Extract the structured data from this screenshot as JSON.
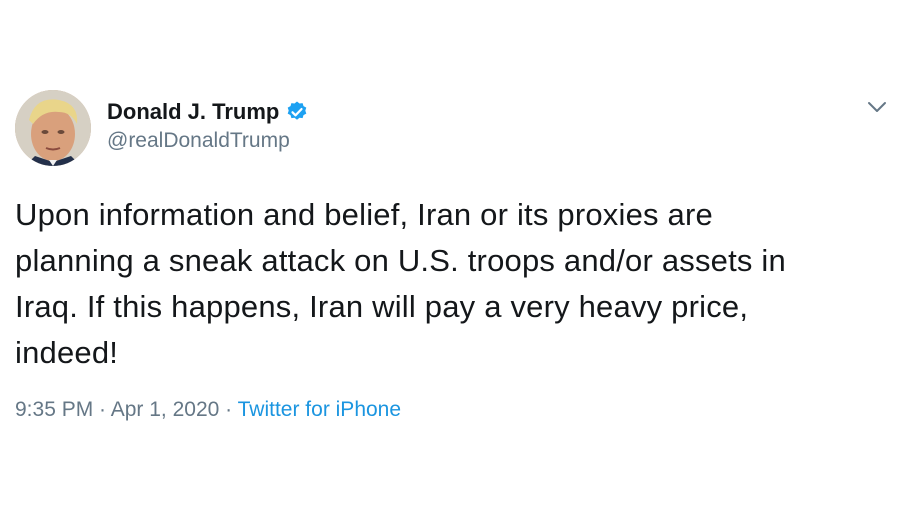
{
  "author": {
    "display_name": "Donald J. Trump",
    "handle": "@realDonaldTrump",
    "verified": true,
    "verified_icon": "verified-badge-icon",
    "avatar": "profile-avatar"
  },
  "menu": {
    "icon": "chevron-down-icon"
  },
  "tweet": {
    "text": "Upon information and belief, Iran or its proxies are\nplanning a sneak attack on U.S. troops and/or assets in\nIraq. If this happens, Iran will pay a very heavy price,\nindeed!"
  },
  "meta": {
    "time": "9:35 PM",
    "separator": " · ",
    "date": "Apr 1, 2020",
    "source": "Twitter for iPhone"
  },
  "colors": {
    "text": "#14171a",
    "secondary": "#657786",
    "link": "#1b95e0",
    "verified": "#1da1f2"
  }
}
